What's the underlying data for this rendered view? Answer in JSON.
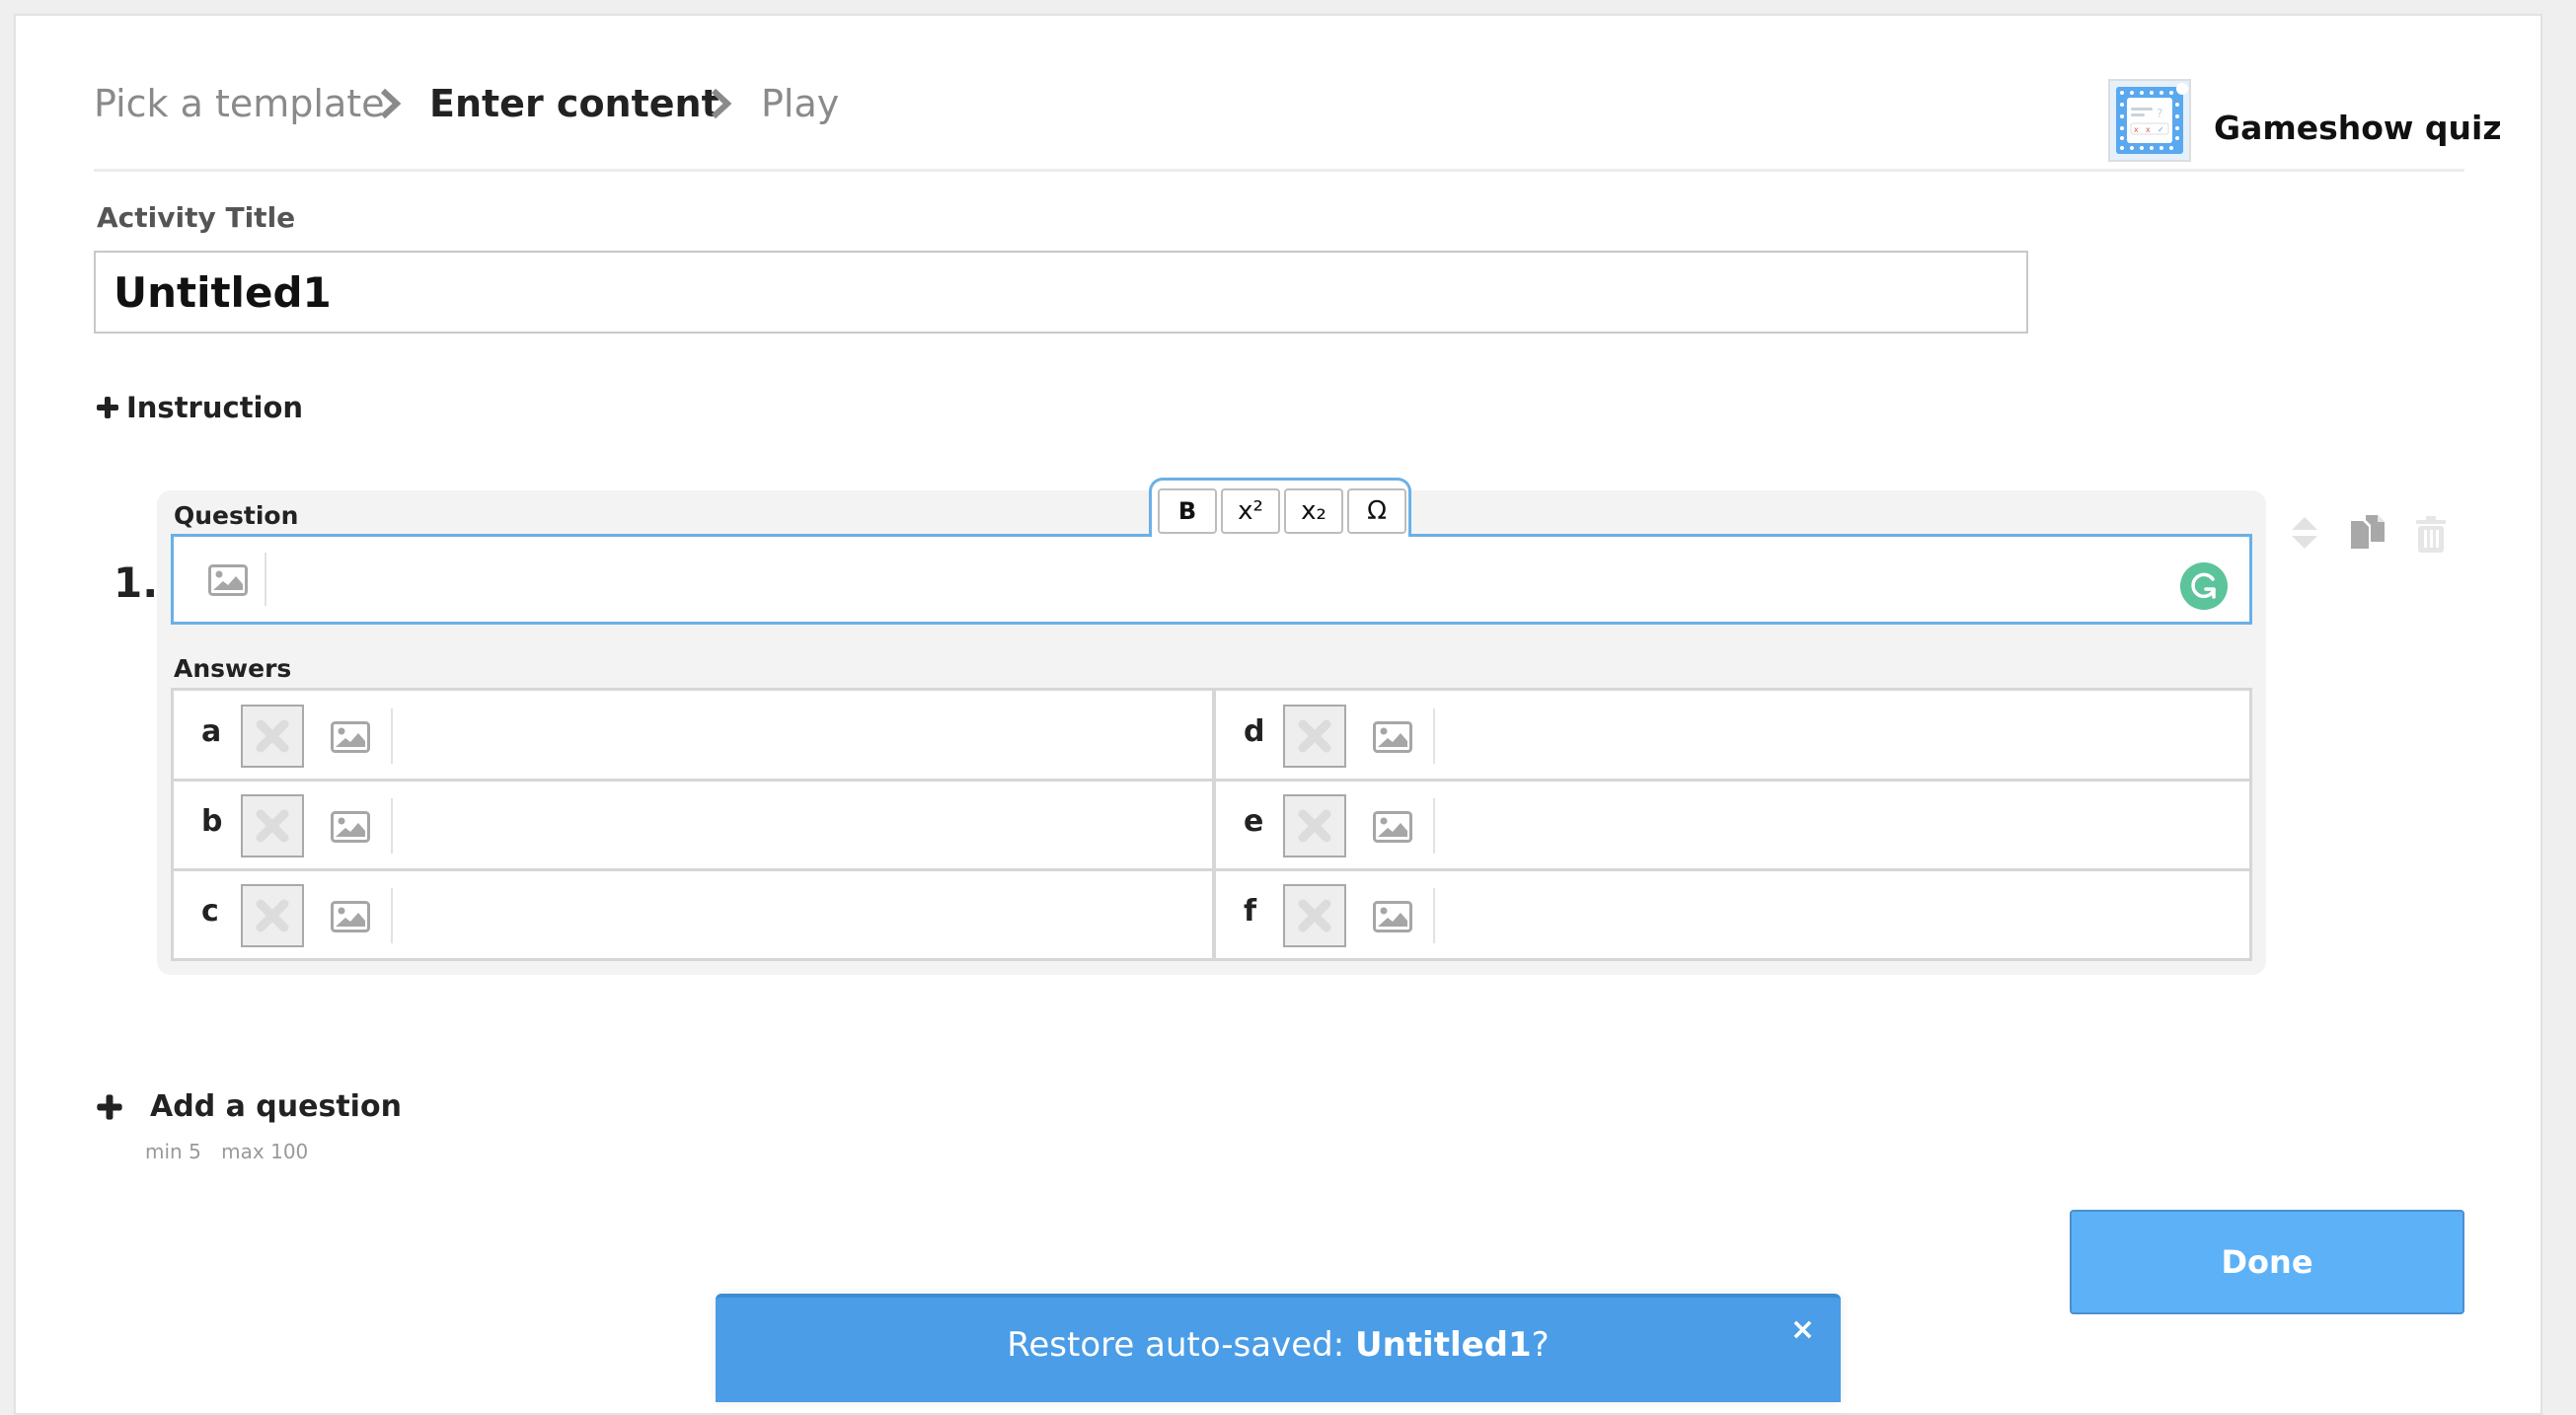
{
  "breadcrumb": {
    "steps": [
      {
        "label": "Pick a template",
        "state": "inactive"
      },
      {
        "label": "Enter content",
        "state": "active"
      },
      {
        "label": "Play",
        "state": "inactive"
      }
    ]
  },
  "template": {
    "name": "Gameshow quiz",
    "icon": "gameshow-quiz-thumbnail"
  },
  "activity_title": {
    "label": "Activity Title",
    "value": "Untitled1"
  },
  "instruction": {
    "label": "Instruction",
    "icon": "plus-icon"
  },
  "question": {
    "number": "1.",
    "label": "Question",
    "value": "",
    "toolbar": [
      {
        "name": "bold",
        "label": "B"
      },
      {
        "name": "superscript",
        "label": "x²"
      },
      {
        "name": "subscript",
        "label": "x₂"
      },
      {
        "name": "special-character",
        "label": "Ω"
      }
    ],
    "side_actions": [
      "reorder-arrows-icon",
      "duplicate-icon",
      "delete-icon"
    ],
    "answers_label": "Answers",
    "answers": [
      {
        "letter": "a",
        "value": ""
      },
      {
        "letter": "b",
        "value": ""
      },
      {
        "letter": "c",
        "value": ""
      },
      {
        "letter": "d",
        "value": ""
      },
      {
        "letter": "e",
        "value": ""
      },
      {
        "letter": "f",
        "value": ""
      }
    ]
  },
  "add_question": {
    "label": "Add a question",
    "min": "min 5",
    "max": "max 100"
  },
  "done_button": {
    "label": "Done"
  },
  "toast": {
    "prefix": "Restore auto-saved: ",
    "title": "Untitled1",
    "suffix": "?",
    "close": "×"
  },
  "colors": {
    "accent": "#5db2f7",
    "toast": "#4a9de6",
    "focus_border": "#6ab0e6",
    "grammarly": "#5cc49b"
  }
}
